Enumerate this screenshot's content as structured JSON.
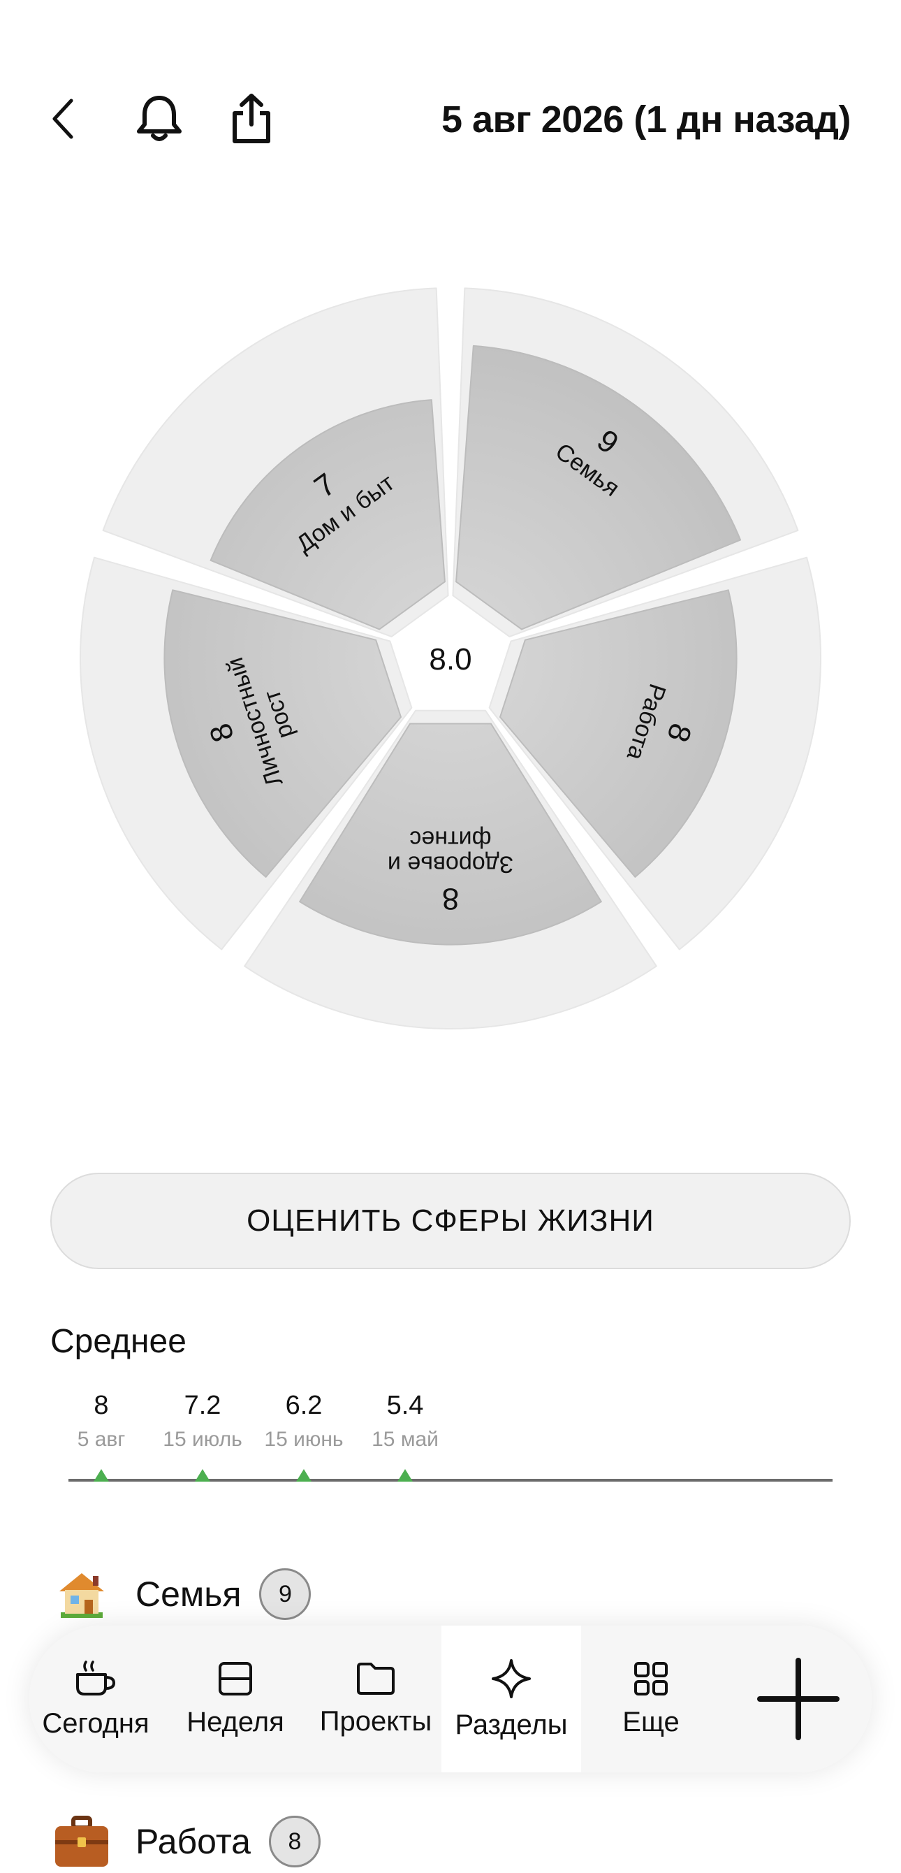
{
  "header": {
    "date_title": "5 авг 2026 (1 дн назад)",
    "back_icon": "chevron-left-icon",
    "bell_icon": "bell-icon",
    "share_icon": "share-icon"
  },
  "wheel": {
    "total": "8.0",
    "max_score": 10,
    "segments": [
      {
        "name": "Семья",
        "score": "9",
        "value": 9
      },
      {
        "name": "Работа",
        "score": "8",
        "value": 8
      },
      {
        "name_line1": "Здоровье и",
        "name_line2": "фитнес",
        "score": "8",
        "value": 8
      },
      {
        "name_line1": "Личностный",
        "name_line2": "рост",
        "score": "8",
        "value": 8
      },
      {
        "name": "Дом и быт",
        "score": "7",
        "value": 7
      }
    ],
    "colors": {
      "outer": "#efefef",
      "inner": "#c8c8c8"
    }
  },
  "rate_button": {
    "label": "ОЦЕНИТЬ СФЕРЫ ЖИЗНИ"
  },
  "average": {
    "title": "Среднее",
    "points": [
      {
        "value": "8",
        "date": "5 авг"
      },
      {
        "value": "7.2",
        "date": "15 июль"
      },
      {
        "value": "6.2",
        "date": "15 июнь"
      },
      {
        "value": "5.4",
        "date": "15 май"
      }
    ],
    "marker_color": "#4caf50"
  },
  "areas": [
    {
      "name": "Семья",
      "score": "9",
      "icon": "house-icon"
    },
    {
      "name": "Работа",
      "score": "8",
      "icon": "briefcase-icon"
    }
  ],
  "tabbar": {
    "tabs": [
      {
        "label": "Сегодня",
        "icon": "coffee-cup-icon"
      },
      {
        "label": "Неделя",
        "icon": "calendar-week-icon"
      },
      {
        "label": "Проекты",
        "icon": "folder-icon"
      },
      {
        "label": "Разделы",
        "icon": "sparkle-icon",
        "active": true
      },
      {
        "label": "Еще",
        "icon": "grid-icon"
      }
    ],
    "add_icon": "plus-icon"
  }
}
